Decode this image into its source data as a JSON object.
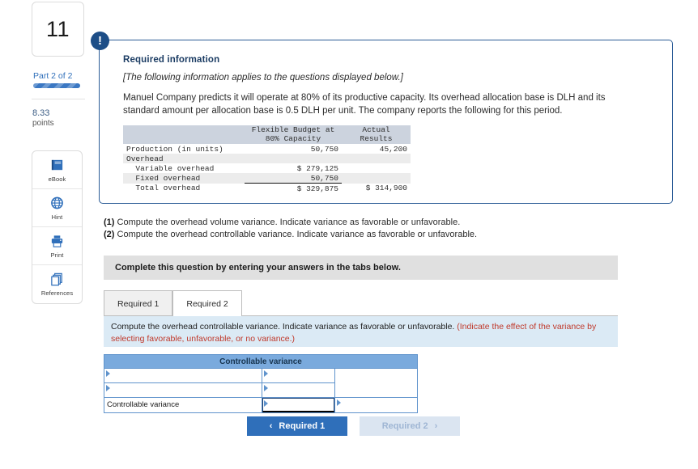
{
  "sidebar": {
    "question_number": "11",
    "part_label": "Part 2 of 2",
    "points_value": "8.33",
    "points_unit": "points",
    "tools": [
      {
        "icon": "ebook-icon",
        "label": "eBook"
      },
      {
        "icon": "hint-globe-icon",
        "label": "Hint"
      },
      {
        "icon": "print-icon",
        "label": "Print"
      },
      {
        "icon": "references-icon",
        "label": "References"
      }
    ]
  },
  "info_panel": {
    "badge_icon": "exclamation-icon",
    "title": "Required information",
    "subtitle": "[The following information applies to the questions displayed below.]",
    "body": "Manuel Company predicts it will operate at 80% of its productive capacity. Its overhead allocation base is DLH and its standard amount per allocation base is 0.5 DLH per unit. The company reports the following for this period.",
    "table": {
      "headers": [
        "",
        "Flexible Budget at 80% Capacity",
        "Actual Results"
      ],
      "rows": [
        {
          "label": "Production (in units)",
          "flexible": "50,750",
          "actual": "45,200",
          "shade": false,
          "underline": false
        },
        {
          "label": "Overhead",
          "flexible": "",
          "actual": "",
          "shade": true,
          "underline": false
        },
        {
          "label": "  Variable overhead",
          "flexible": "$ 279,125",
          "actual": "",
          "shade": false,
          "underline": false
        },
        {
          "label": "  Fixed overhead",
          "flexible": "50,750",
          "actual": "",
          "shade": true,
          "underline": true
        },
        {
          "label": "  Total overhead",
          "flexible": "$ 329,875",
          "actual": "$ 314,900",
          "shade": false,
          "underline": false
        }
      ]
    }
  },
  "questions": [
    {
      "num": "(1)",
      "text": "Compute the overhead volume variance. Indicate variance as favorable or unfavorable."
    },
    {
      "num": "(2)",
      "text": "Compute the overhead controllable variance. Indicate variance as favorable or unfavorable."
    }
  ],
  "complete_bar": "Complete this question by entering your answers in the tabs below.",
  "tabs": [
    {
      "label": "Required 1",
      "active": false
    },
    {
      "label": "Required 2",
      "active": true
    }
  ],
  "instruction": {
    "main": "Compute the overhead controllable variance. Indicate variance as favorable or unfavorable. ",
    "warning": "(Indicate the effect of the variance by selecting favorable, unfavorable, or no variance.)"
  },
  "answer_table": {
    "header": "Controllable variance",
    "rows": [
      {
        "label": "",
        "col2": "",
        "col3": ""
      },
      {
        "label": "",
        "col2": "",
        "col3": ""
      },
      {
        "label": "Controllable variance",
        "col2": "",
        "col3": ""
      }
    ]
  },
  "nav": {
    "prev_chevron": "‹",
    "prev_label": "Required 1",
    "next_label": "Required 2",
    "next_chevron": "›"
  }
}
